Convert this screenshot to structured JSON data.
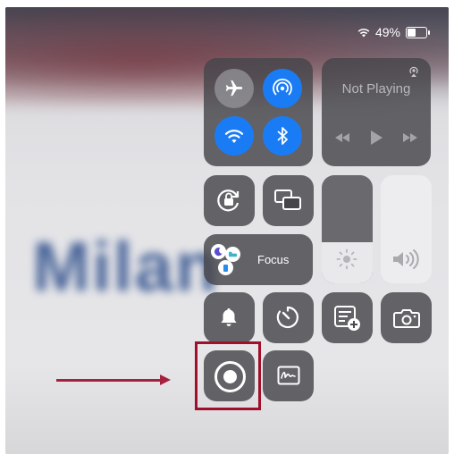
{
  "status_bar": {
    "battery_text": "49%",
    "battery_level": 0.49,
    "wifi_icon": "wifi-icon"
  },
  "background": {
    "blurred_word": "Milan"
  },
  "connectivity": {
    "airplane": {
      "icon": "airplane-icon",
      "on": false
    },
    "airdrop": {
      "icon": "airdrop-icon",
      "on": true
    },
    "wifi": {
      "icon": "wifi-icon",
      "on": true
    },
    "bluetooth": {
      "icon": "bluetooth-icon",
      "on": true
    }
  },
  "now_playing": {
    "title": "Not Playing",
    "airplay_icon": "airplay-icon"
  },
  "focus": {
    "label": "Focus"
  },
  "sliders": {
    "brightness_level": 0.38,
    "volume_level": 0.48
  },
  "controls": [
    "orientation-lock",
    "screen-mirroring",
    "silent-mode",
    "timer",
    "quick-note",
    "camera",
    "screen-recording",
    "signature"
  ],
  "colors": {
    "active_blue": "#1a7cf5",
    "annotation_red": "#a0102b"
  }
}
